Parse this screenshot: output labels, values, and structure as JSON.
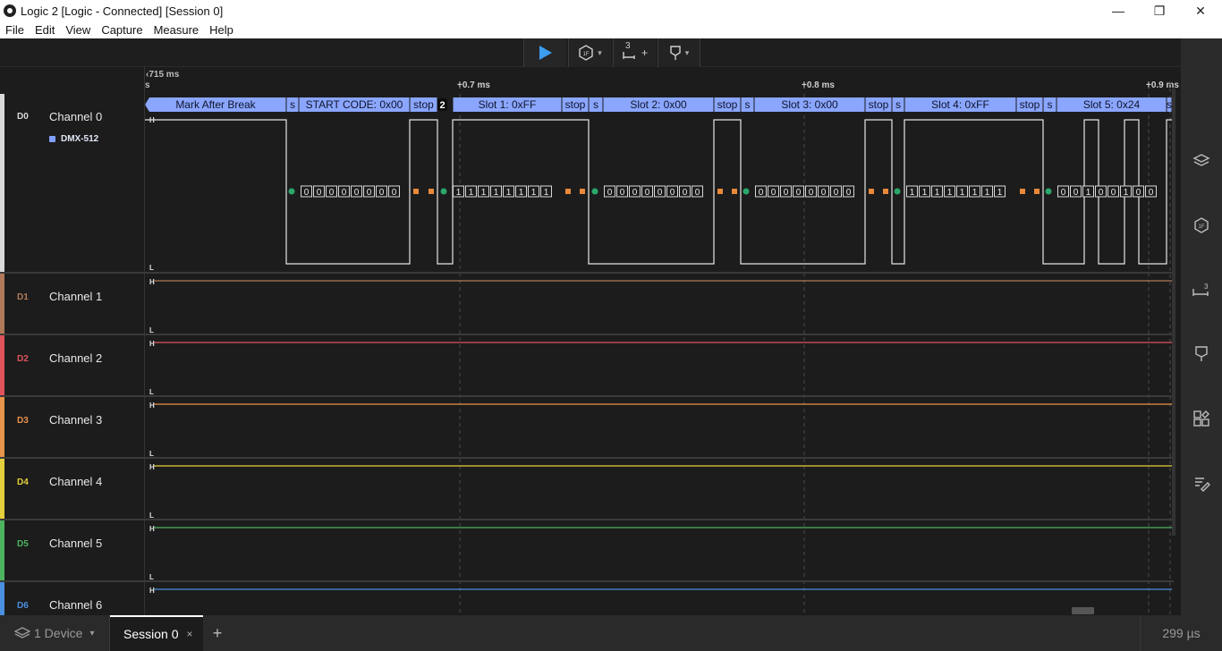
{
  "window": {
    "title": "Logic 2 [Logic - Connected] [Session 0]",
    "minimize_glyph": "—",
    "maximize_glyph": "❐",
    "close_glyph": "✕"
  },
  "menu": [
    "File",
    "Edit",
    "View",
    "Capture",
    "Measure",
    "Help"
  ],
  "toolbar": {
    "play_icon": "play-icon",
    "measure_label": "3",
    "measure_plus": "+"
  },
  "timeline": {
    "start_label": "715 ms",
    "start_unit": "s",
    "ticks": [
      {
        "label": "+0.7 ms"
      },
      {
        "label": "+0.8 ms"
      },
      {
        "label": "+0.9 ms"
      }
    ]
  },
  "channels": [
    {
      "id": "D0",
      "name": "Channel 0",
      "color": "#d9d9d9",
      "analyzer": "DMX-512"
    },
    {
      "id": "D1",
      "name": "Channel 1",
      "color": "#b07a5a"
    },
    {
      "id": "D2",
      "name": "Channel 2",
      "color": "#e0535d"
    },
    {
      "id": "D3",
      "name": "Channel 3",
      "color": "#e8934a"
    },
    {
      "id": "D4",
      "name": "Channel 4",
      "color": "#e5cf3c"
    },
    {
      "id": "D5",
      "name": "Channel 5",
      "color": "#4cb35f"
    },
    {
      "id": "D6",
      "name": "Channel 6",
      "color": "#4a8fe0"
    }
  ],
  "levels": {
    "high": "H",
    "low": "L"
  },
  "frames": [
    {
      "label": "Mark After Break"
    },
    {
      "label": "s"
    },
    {
      "label": "START CODE: 0x00"
    },
    {
      "label": "stop"
    },
    {
      "label": "Slot 1: 0xFF"
    },
    {
      "label": "stop"
    },
    {
      "label": "s"
    },
    {
      "label": "Slot 2: 0x00"
    },
    {
      "label": "stop"
    },
    {
      "label": "s"
    },
    {
      "label": "Slot 3: 0x00"
    },
    {
      "label": "stop"
    },
    {
      "label": "s"
    },
    {
      "label": "Slot 4: 0xFF"
    },
    {
      "label": "stop"
    },
    {
      "label": "s"
    },
    {
      "label": "Slot 5: 0x24"
    },
    {
      "label": "s"
    }
  ],
  "marker_badge": "2",
  "bit_groups": [
    {
      "bits": [
        "0",
        "0",
        "0",
        "0",
        "0",
        "0",
        "0",
        "0"
      ]
    },
    {
      "bits": [
        "1",
        "1",
        "1",
        "1",
        "1",
        "1",
        "1",
        "1"
      ]
    },
    {
      "bits": [
        "0",
        "0",
        "0",
        "0",
        "0",
        "0",
        "0",
        "0"
      ]
    },
    {
      "bits": [
        "0",
        "0",
        "0",
        "0",
        "0",
        "0",
        "0",
        "0"
      ]
    },
    {
      "bits": [
        "1",
        "1",
        "1",
        "1",
        "1",
        "1",
        "1",
        "1"
      ]
    },
    {
      "bits": [
        "0",
        "0",
        "1",
        "0",
        "0",
        "1",
        "0",
        "0"
      ]
    }
  ],
  "colors": {
    "frame_fill": "#8aa6ff",
    "frame_text": "#10142a",
    "start_dot": "#2aa86a",
    "stop_square": "#e8893a",
    "accent_play": "#3b9ef0"
  },
  "bottom": {
    "device_label": "1 Device",
    "session_label": "Session 0",
    "close_glyph": "×",
    "add_glyph": "+",
    "timing": "299 µs"
  }
}
